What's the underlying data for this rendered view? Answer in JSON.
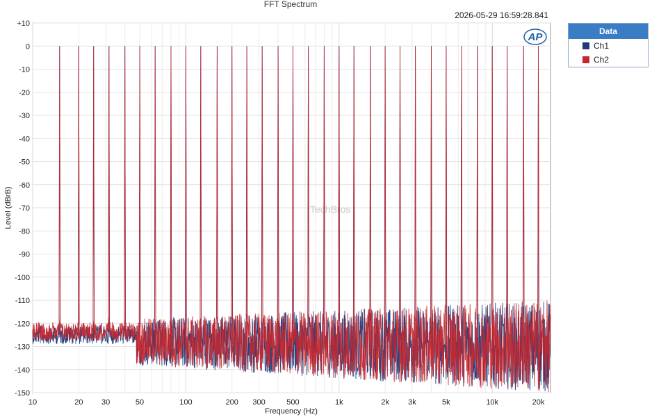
{
  "chart_data": {
    "type": "line",
    "title": "FFT Spectrum",
    "timestamp": "2026-05-29 16:59:28.841",
    "xlabel": "Frequency (Hz)",
    "ylabel": "Level (dBrB)",
    "x_scale": "log",
    "xlim": [
      10,
      24000
    ],
    "ylim": [
      -150,
      10
    ],
    "grid": true,
    "watermark": "TechBros",
    "logo": "AP",
    "x_ticks": [
      {
        "value": 10,
        "label": "10"
      },
      {
        "value": 20,
        "label": "20"
      },
      {
        "value": 30,
        "label": "30"
      },
      {
        "value": 50,
        "label": "50"
      },
      {
        "value": 100,
        "label": "100"
      },
      {
        "value": 200,
        "label": "200"
      },
      {
        "value": 300,
        "label": "300"
      },
      {
        "value": 500,
        "label": "500"
      },
      {
        "value": 1000,
        "label": "1k"
      },
      {
        "value": 2000,
        "label": "2k"
      },
      {
        "value": 3000,
        "label": "3k"
      },
      {
        "value": 5000,
        "label": "5k"
      },
      {
        "value": 10000,
        "label": "10k"
      },
      {
        "value": 20000,
        "label": "20k"
      }
    ],
    "y_ticks": [
      {
        "value": 10,
        "label": "+10"
      },
      {
        "value": 0,
        "label": "0"
      },
      {
        "value": -10,
        "label": "-10"
      },
      {
        "value": -20,
        "label": "-20"
      },
      {
        "value": -30,
        "label": "-30"
      },
      {
        "value": -40,
        "label": "-40"
      },
      {
        "value": -50,
        "label": "-50"
      },
      {
        "value": -60,
        "label": "-60"
      },
      {
        "value": -70,
        "label": "-70"
      },
      {
        "value": -80,
        "label": "-80"
      },
      {
        "value": -90,
        "label": "-90"
      },
      {
        "value": -100,
        "label": "-100"
      },
      {
        "value": -110,
        "label": "-110"
      },
      {
        "value": -120,
        "label": "-120"
      },
      {
        "value": -130,
        "label": "-130"
      },
      {
        "value": -140,
        "label": "-140"
      },
      {
        "value": -150,
        "label": "-150"
      }
    ],
    "tone_frequencies": [
      15,
      20,
      25,
      31.5,
      40,
      50,
      63,
      80,
      100,
      125,
      160,
      200,
      250,
      315,
      400,
      500,
      630,
      800,
      1000,
      1250,
      1600,
      2000,
      2500,
      3150,
      4000,
      5000,
      6300,
      8000,
      10000,
      12500,
      16000,
      20000
    ],
    "tone_level": 0,
    "noise_floor_low": [
      -120,
      -135
    ],
    "noise_floor_high": [
      -110,
      -150
    ],
    "legend": {
      "title": "Data",
      "placement": "right"
    },
    "series": [
      {
        "name": "Ch1",
        "color": "#1f3a7a"
      },
      {
        "name": "Ch2",
        "color": "#c8262b"
      }
    ]
  }
}
